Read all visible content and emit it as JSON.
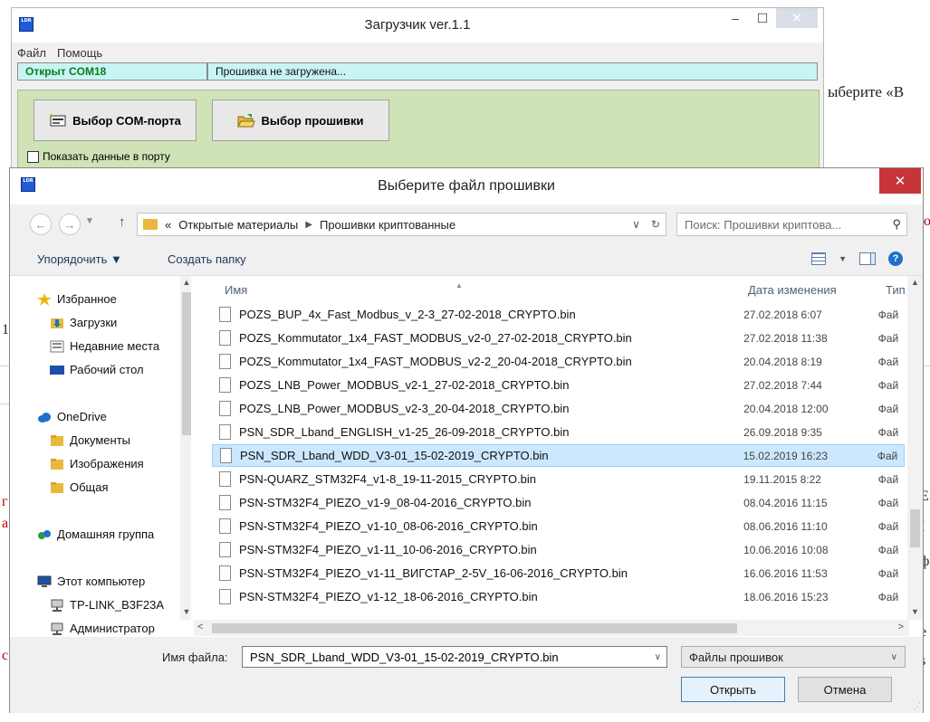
{
  "background_doc": {
    "right_text": "ыберите «В",
    "red_top": "ю",
    "left_mark1": "1",
    "left_mark2": "r",
    "left_mark3": "1",
    "red_left1": "г",
    "red_left2": "а",
    "red_left3": "с",
    "right_mark1": "Е",
    "right_mark2": "І",
    "right_mark3": "ф",
    "right_mark4": "е",
    "right_mark5": "s"
  },
  "loader": {
    "title": "Загрузчик  ver.1.1",
    "icon_text": "LDR",
    "menu": [
      "Файл",
      "Помощь"
    ],
    "status_com": "Открыт COM18",
    "status_firmware": "Прошивка не загружена...",
    "btn_com": "Выбор COM-порта",
    "btn_firmware": "Выбор прошивки",
    "checkbox_label": "Показать данные в порту",
    "win_minimize": "–",
    "win_maximize": "☐",
    "win_close": "✕"
  },
  "dialog": {
    "title": "Выберите файл прошивки",
    "icon_text": "LDR",
    "close": "✕",
    "back": "←",
    "forward": "→",
    "up": "↑",
    "breadcrumb_prefix": "«",
    "breadcrumb": [
      "Открытые материалы",
      "Прошивки криптованные"
    ],
    "breadcrumb_sep": "▶",
    "addr_dropdown": "∨",
    "refresh": "↻",
    "search_placeholder": "Поиск: Прошивки криптова...",
    "search_glyph": "⚲",
    "organize": "Упорядочить ▼",
    "new_folder": "Создать папку",
    "help_glyph": "?",
    "view_dropdown": "▼",
    "nav_items": [
      {
        "label": "Избранное",
        "icon": "star-icon"
      },
      {
        "label": "Загрузки",
        "icon": "downloads-icon"
      },
      {
        "label": "Недавние места",
        "icon": "recent-places-icon"
      },
      {
        "label": "Рабочий стол",
        "icon": "desktop-icon"
      },
      {
        "label": "OneDrive",
        "icon": "cloud-icon"
      },
      {
        "label": "Документы",
        "icon": "folder-icon"
      },
      {
        "label": "Изображения",
        "icon": "folder-icon"
      },
      {
        "label": "Общая",
        "icon": "folder-icon"
      },
      {
        "label": "Домашняя группа",
        "icon": "homegroup-icon"
      },
      {
        "label": "Этот компьютер",
        "icon": "computer-icon"
      },
      {
        "label": "TP-LINK_B3F23A",
        "icon": "network-drive-icon"
      },
      {
        "label": "Администратор",
        "icon": "network-drive-icon"
      }
    ],
    "columns": {
      "name": "Имя",
      "date": "Дата изменения",
      "type": "Тип"
    },
    "files": [
      {
        "name": "POZS_BUP_4x_Fast_Modbus_v_2-3_27-02-2018_CRYPTO.bin",
        "date": "27.02.2018 6:07",
        "type": "Фай"
      },
      {
        "name": "POZS_Kommutator_1x4_FAST_MODBUS_v2-0_27-02-2018_CRYPTO.bin",
        "date": "27.02.2018 11:38",
        "type": "Фай"
      },
      {
        "name": "POZS_Kommutator_1x4_FAST_MODBUS_v2-2_20-04-2018_CRYPTO.bin",
        "date": "20.04.2018 8:19",
        "type": "Фай"
      },
      {
        "name": "POZS_LNB_Power_MODBUS_v2-1_27-02-2018_CRYPTO.bin",
        "date": "27.02.2018 7:44",
        "type": "Фай"
      },
      {
        "name": "POZS_LNB_Power_MODBUS_v2-3_20-04-2018_CRYPTO.bin",
        "date": "20.04.2018 12:00",
        "type": "Фай"
      },
      {
        "name": "PSN_SDR_Lband_ENGLISH_v1-25_26-09-2018_CRYPTO.bin",
        "date": "26.09.2018 9:35",
        "type": "Фай"
      },
      {
        "name": "PSN_SDR_Lband_WDD_V3-01_15-02-2019_CRYPTO.bin",
        "date": "15.02.2019 16:23",
        "type": "Фай",
        "selected": true
      },
      {
        "name": "PSN-QUARZ_STM32F4_v1-8_19-11-2015_CRYPTO.bin",
        "date": "19.11.2015 8:22",
        "type": "Фай"
      },
      {
        "name": "PSN-STM32F4_PIEZO_v1-9_08-04-2016_CRYPTO.bin",
        "date": "08.04.2016 11:15",
        "type": "Фай"
      },
      {
        "name": "PSN-STM32F4_PIEZO_v1-10_08-06-2016_CRYPTO.bin",
        "date": "08.06.2016 11:10",
        "type": "Фай"
      },
      {
        "name": "PSN-STM32F4_PIEZO_v1-11_10-06-2016_CRYPTO.bin",
        "date": "10.06.2016 10:08",
        "type": "Фай"
      },
      {
        "name": "PSN-STM32F4_PIEZO_v1-11_ВИГСТАР_2-5V_16-06-2016_CRYPTO.bin",
        "date": "16.06.2016 11:53",
        "type": "Фай"
      },
      {
        "name": "PSN-STM32F4_PIEZO_v1-12_18-06-2016_CRYPTO.bin",
        "date": "18.06.2016 15:23",
        "type": "Фай"
      }
    ],
    "filename_label": "Имя файла:",
    "filename_value": "PSN_SDR_Lband_WDD_V3-01_15-02-2019_CRYPTO.bin",
    "filter": "Файлы прошивок",
    "open_btn": "Открыть",
    "cancel_btn": "Отмена",
    "dropdown_glyph": "∨",
    "scroll_up": "▲",
    "scroll_down": "▼",
    "scroll_left": "<",
    "scroll_right": ">",
    "grip": "⋰"
  },
  "colors": {
    "status_bg": "#c9f4f4",
    "panel_green": "#cfe3b6",
    "selection": "#cce8ff",
    "close_red": "#c7343a"
  }
}
